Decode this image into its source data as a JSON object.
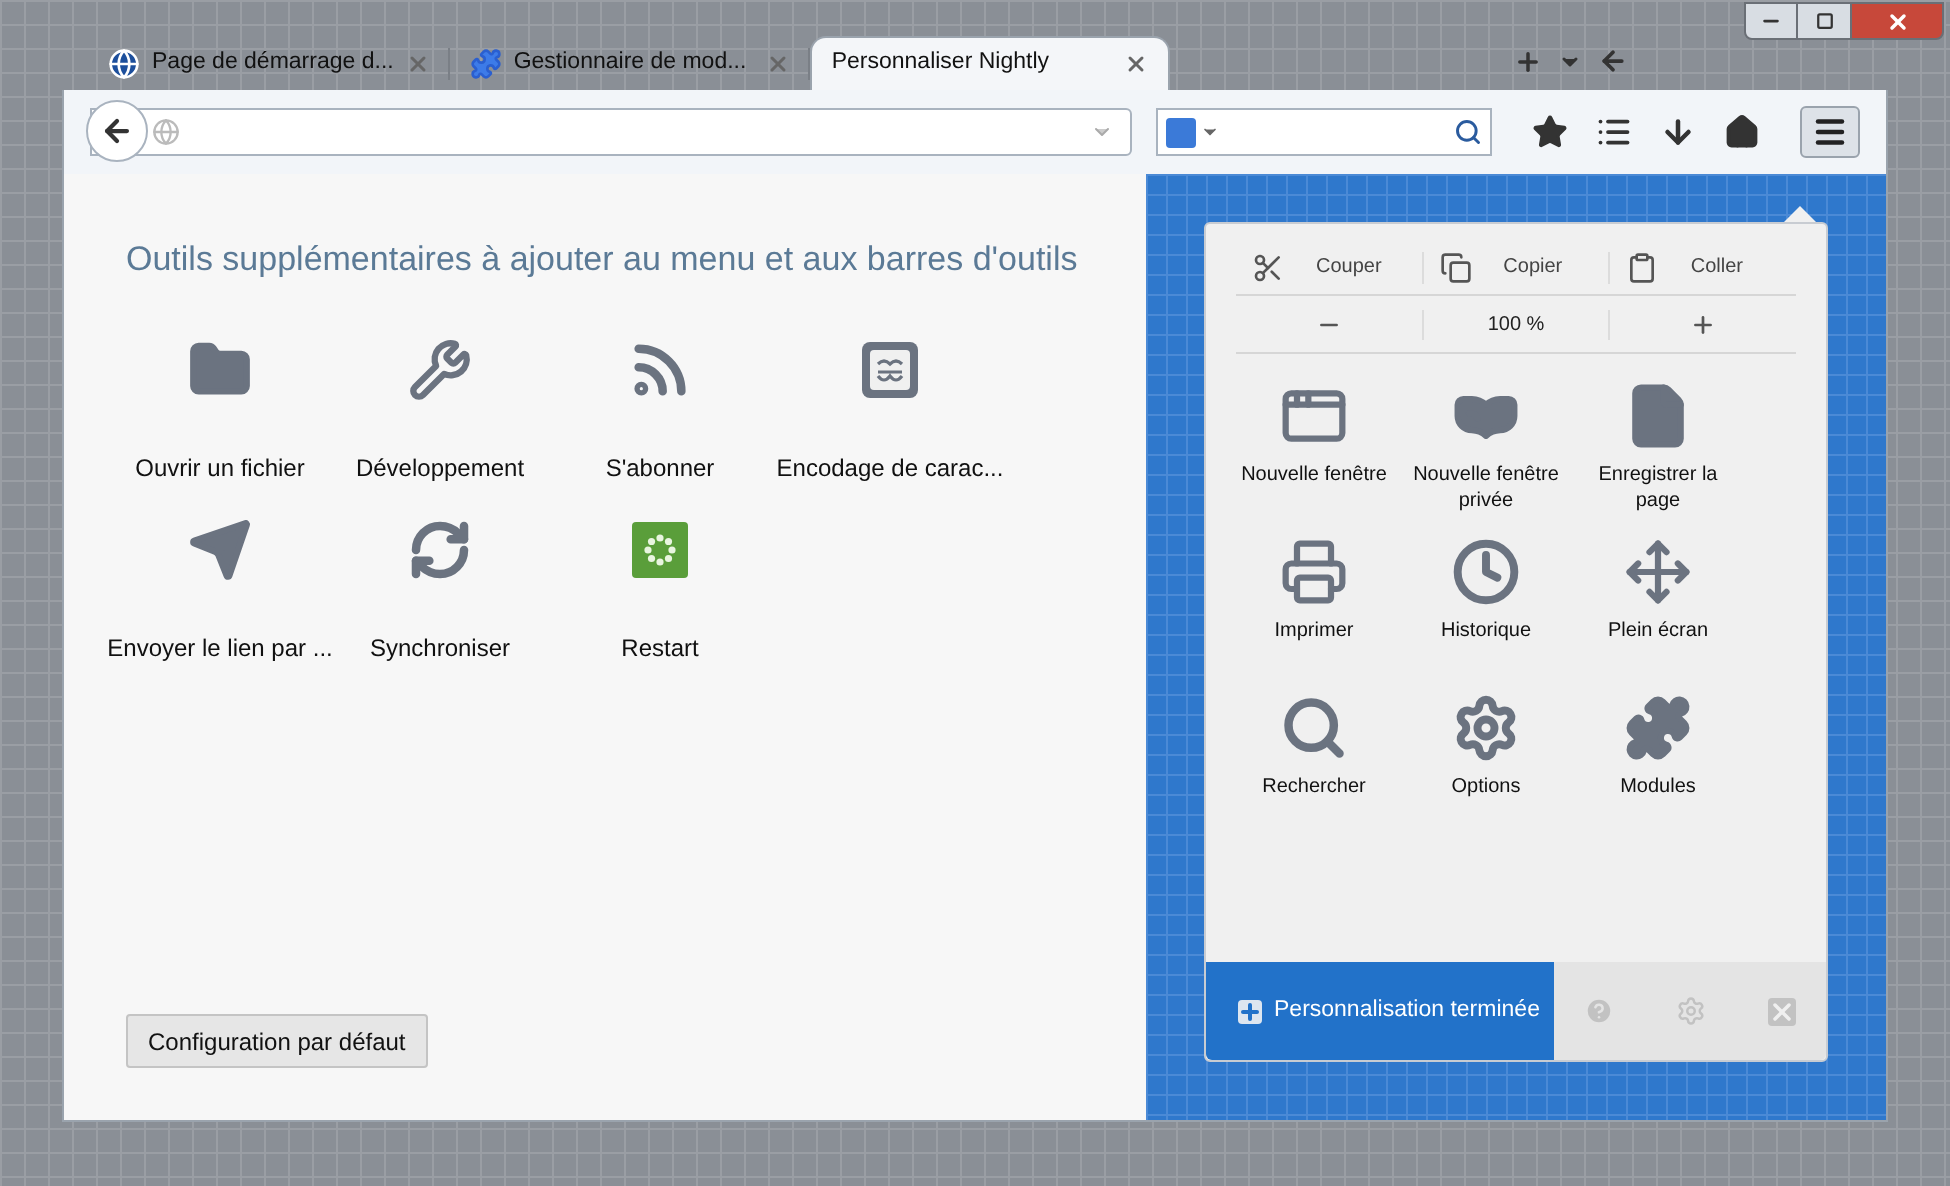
{
  "tabs": [
    {
      "label": "Page de démarrage d...",
      "selected": false,
      "kind": "globe"
    },
    {
      "label": "Gestionnaire de mod...",
      "selected": false,
      "kind": "puzzle"
    },
    {
      "label": "Personnaliser Nightly",
      "selected": true,
      "kind": "plain"
    }
  ],
  "palette": {
    "title": "Outils supplémentaires à ajouter au menu et aux barres d'outils",
    "items": [
      {
        "label": "Ouvrir un fichier",
        "kind": "folder"
      },
      {
        "label": "Développement",
        "kind": "wrench"
      },
      {
        "label": "S'abonner",
        "kind": "rss"
      },
      {
        "label": "Encodage de carac...",
        "kind": "encoding"
      },
      {
        "label": "Envoyer le lien par ...",
        "kind": "send"
      },
      {
        "label": "Synchroniser",
        "kind": "sync"
      },
      {
        "label": "Restart",
        "kind": "restart"
      }
    ]
  },
  "reset_button": "Configuration par défaut",
  "menu": {
    "edit": [
      {
        "label": "Couper",
        "kind": "cut"
      },
      {
        "label": "Copier",
        "kind": "copy"
      },
      {
        "label": "Coller",
        "kind": "paste"
      }
    ],
    "zoom": "100 %",
    "items": [
      {
        "label": "Nouvelle fenêtre",
        "kind": "window"
      },
      {
        "label": "Nouvelle fenêtre privée",
        "kind": "mask"
      },
      {
        "label": "Enregistrer la page",
        "kind": "file"
      },
      {
        "label": "Imprimer",
        "kind": "printer"
      },
      {
        "label": "Historique",
        "kind": "clock"
      },
      {
        "label": "Plein écran",
        "kind": "move"
      },
      {
        "label": "Rechercher",
        "kind": "search"
      },
      {
        "label": "Options",
        "kind": "gear"
      },
      {
        "label": "Modules",
        "kind": "puzzle"
      }
    ],
    "done_button": "Personnalisation terminée"
  }
}
